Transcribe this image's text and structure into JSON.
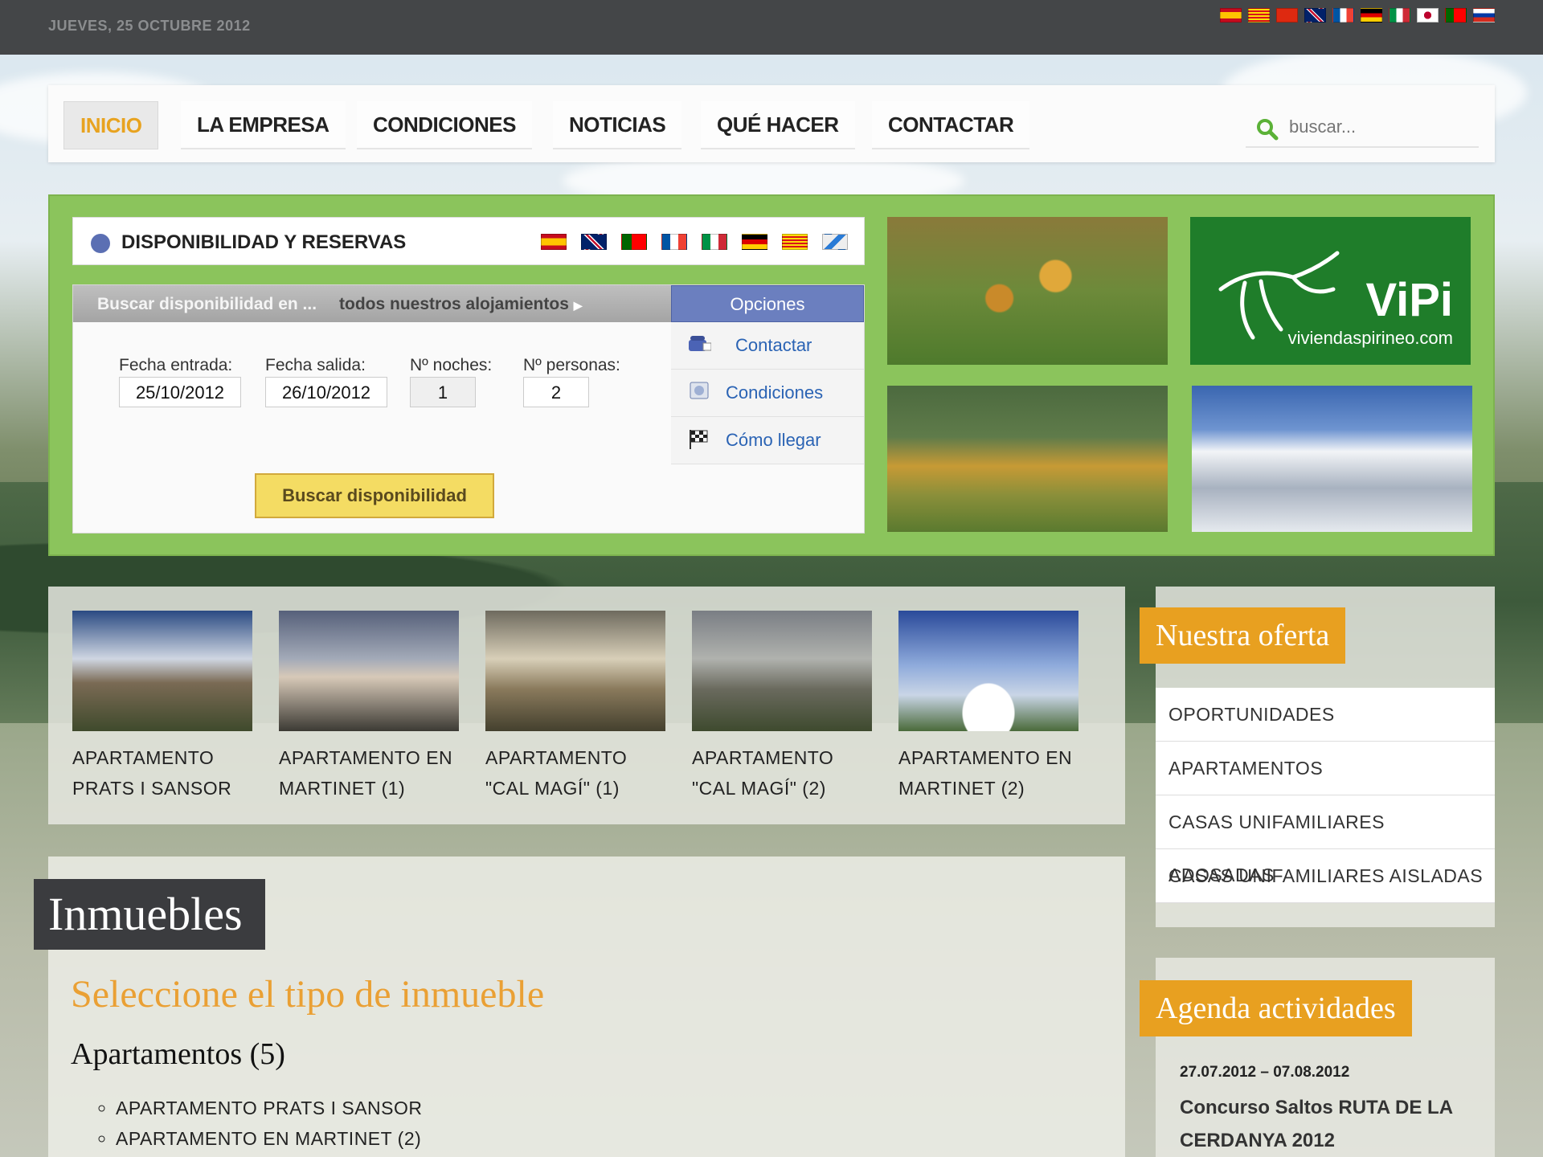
{
  "topbar": {
    "date": "JUEVES, 25 OCTUBRE 2012",
    "languages": [
      "es-flag",
      "ca-flag",
      "cn-flag",
      "uk-flag",
      "fr-flag",
      "de-flag",
      "it-flag",
      "jp-flag",
      "pt-flag",
      "ru-flag"
    ]
  },
  "nav": {
    "items": [
      "INICIO",
      "LA EMPRESA",
      "CONDICIONES",
      "NOTICIAS",
      "QUÉ HACER",
      "CONTACTAR"
    ],
    "active": "INICIO",
    "search_placeholder": "buscar..."
  },
  "availability": {
    "title": "DISPONIBILIDAD Y RESERVAS",
    "flags": [
      "es-flag",
      "uk-flag",
      "pt-flag",
      "fr-flag",
      "it-flag",
      "de-flag",
      "ca-flag",
      "other-flag"
    ],
    "bar_left": "Buscar disponibilidad en ...",
    "bar_right": "todos nuestros alojamientos",
    "labels": {
      "entrada": "Fecha entrada:",
      "salida": "Fecha salida:",
      "noches": "Nº noches:",
      "personas": "Nº personas:"
    },
    "values": {
      "entrada": "25/10/2012",
      "salida": "26/10/2012",
      "noches": "1",
      "personas": "2"
    },
    "search_button": "Buscar disponibilidad",
    "options_title": "Opciones",
    "options": [
      "Contactar",
      "Condiciones",
      "Cómo llegar"
    ]
  },
  "brand": {
    "logo_text": "ViPi",
    "logo_url": "viviendaspirineo.com"
  },
  "properties": [
    {
      "name": "APARTAMENTO PRATS I SANSOR"
    },
    {
      "name": "APARTAMENTO EN MARTINET (1)"
    },
    {
      "name": "APARTAMENTO \"CAL MAGÍ\" (1)"
    },
    {
      "name": "APARTAMENTO \"CAL MAGÍ\" (2)"
    },
    {
      "name": "APARTAMENTO EN MARTINET (2)"
    }
  ],
  "inmuebles": {
    "title": "Inmuebles",
    "subtitle": "Seleccione el tipo de inmueble",
    "group": "Apartamentos (5)",
    "items": [
      "APARTAMENTO PRATS I SANSOR",
      "APARTAMENTO EN MARTINET (2)"
    ]
  },
  "sidebar": {
    "oferta_title": "Nuestra oferta",
    "oferta_items": [
      "OPORTUNIDADES",
      "APARTAMENTOS",
      "CASAS UNIFAMILIARES ADOSADAS",
      "CASAS UNIFAMILIARES AISLADAS"
    ],
    "agenda_title": "Agenda actividades",
    "agenda_date": "27.07.2012 – 07.08.2012",
    "agenda_event": "Concurso Saltos RUTA DE LA CERDANYA 2012"
  },
  "colors": {
    "accent": "#e8a020",
    "green_panel": "#8bc45c",
    "topbar": "#444648",
    "options_blue": "#6b7fbf"
  }
}
